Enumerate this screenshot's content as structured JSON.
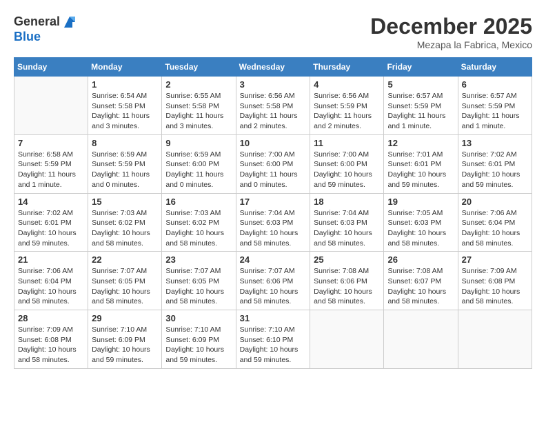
{
  "header": {
    "logo_general": "General",
    "logo_blue": "Blue",
    "month": "December 2025",
    "location": "Mezapa la Fabrica, Mexico"
  },
  "days_of_week": [
    "Sunday",
    "Monday",
    "Tuesday",
    "Wednesday",
    "Thursday",
    "Friday",
    "Saturday"
  ],
  "weeks": [
    [
      {
        "day": "",
        "info": ""
      },
      {
        "day": "1",
        "info": "Sunrise: 6:54 AM\nSunset: 5:58 PM\nDaylight: 11 hours\nand 3 minutes."
      },
      {
        "day": "2",
        "info": "Sunrise: 6:55 AM\nSunset: 5:58 PM\nDaylight: 11 hours\nand 3 minutes."
      },
      {
        "day": "3",
        "info": "Sunrise: 6:56 AM\nSunset: 5:58 PM\nDaylight: 11 hours\nand 2 minutes."
      },
      {
        "day": "4",
        "info": "Sunrise: 6:56 AM\nSunset: 5:59 PM\nDaylight: 11 hours\nand 2 minutes."
      },
      {
        "day": "5",
        "info": "Sunrise: 6:57 AM\nSunset: 5:59 PM\nDaylight: 11 hours\nand 1 minute."
      },
      {
        "day": "6",
        "info": "Sunrise: 6:57 AM\nSunset: 5:59 PM\nDaylight: 11 hours\nand 1 minute."
      }
    ],
    [
      {
        "day": "7",
        "info": "Sunrise: 6:58 AM\nSunset: 5:59 PM\nDaylight: 11 hours\nand 1 minute."
      },
      {
        "day": "8",
        "info": "Sunrise: 6:59 AM\nSunset: 5:59 PM\nDaylight: 11 hours\nand 0 minutes."
      },
      {
        "day": "9",
        "info": "Sunrise: 6:59 AM\nSunset: 6:00 PM\nDaylight: 11 hours\nand 0 minutes."
      },
      {
        "day": "10",
        "info": "Sunrise: 7:00 AM\nSunset: 6:00 PM\nDaylight: 11 hours\nand 0 minutes."
      },
      {
        "day": "11",
        "info": "Sunrise: 7:00 AM\nSunset: 6:00 PM\nDaylight: 10 hours\nand 59 minutes."
      },
      {
        "day": "12",
        "info": "Sunrise: 7:01 AM\nSunset: 6:01 PM\nDaylight: 10 hours\nand 59 minutes."
      },
      {
        "day": "13",
        "info": "Sunrise: 7:02 AM\nSunset: 6:01 PM\nDaylight: 10 hours\nand 59 minutes."
      }
    ],
    [
      {
        "day": "14",
        "info": "Sunrise: 7:02 AM\nSunset: 6:01 PM\nDaylight: 10 hours\nand 59 minutes."
      },
      {
        "day": "15",
        "info": "Sunrise: 7:03 AM\nSunset: 6:02 PM\nDaylight: 10 hours\nand 58 minutes."
      },
      {
        "day": "16",
        "info": "Sunrise: 7:03 AM\nSunset: 6:02 PM\nDaylight: 10 hours\nand 58 minutes."
      },
      {
        "day": "17",
        "info": "Sunrise: 7:04 AM\nSunset: 6:03 PM\nDaylight: 10 hours\nand 58 minutes."
      },
      {
        "day": "18",
        "info": "Sunrise: 7:04 AM\nSunset: 6:03 PM\nDaylight: 10 hours\nand 58 minutes."
      },
      {
        "day": "19",
        "info": "Sunrise: 7:05 AM\nSunset: 6:03 PM\nDaylight: 10 hours\nand 58 minutes."
      },
      {
        "day": "20",
        "info": "Sunrise: 7:06 AM\nSunset: 6:04 PM\nDaylight: 10 hours\nand 58 minutes."
      }
    ],
    [
      {
        "day": "21",
        "info": "Sunrise: 7:06 AM\nSunset: 6:04 PM\nDaylight: 10 hours\nand 58 minutes."
      },
      {
        "day": "22",
        "info": "Sunrise: 7:07 AM\nSunset: 6:05 PM\nDaylight: 10 hours\nand 58 minutes."
      },
      {
        "day": "23",
        "info": "Sunrise: 7:07 AM\nSunset: 6:05 PM\nDaylight: 10 hours\nand 58 minutes."
      },
      {
        "day": "24",
        "info": "Sunrise: 7:07 AM\nSunset: 6:06 PM\nDaylight: 10 hours\nand 58 minutes."
      },
      {
        "day": "25",
        "info": "Sunrise: 7:08 AM\nSunset: 6:06 PM\nDaylight: 10 hours\nand 58 minutes."
      },
      {
        "day": "26",
        "info": "Sunrise: 7:08 AM\nSunset: 6:07 PM\nDaylight: 10 hours\nand 58 minutes."
      },
      {
        "day": "27",
        "info": "Sunrise: 7:09 AM\nSunset: 6:08 PM\nDaylight: 10 hours\nand 58 minutes."
      }
    ],
    [
      {
        "day": "28",
        "info": "Sunrise: 7:09 AM\nSunset: 6:08 PM\nDaylight: 10 hours\nand 58 minutes."
      },
      {
        "day": "29",
        "info": "Sunrise: 7:10 AM\nSunset: 6:09 PM\nDaylight: 10 hours\nand 59 minutes."
      },
      {
        "day": "30",
        "info": "Sunrise: 7:10 AM\nSunset: 6:09 PM\nDaylight: 10 hours\nand 59 minutes."
      },
      {
        "day": "31",
        "info": "Sunrise: 7:10 AM\nSunset: 6:10 PM\nDaylight: 10 hours\nand 59 minutes."
      },
      {
        "day": "",
        "info": ""
      },
      {
        "day": "",
        "info": ""
      },
      {
        "day": "",
        "info": ""
      }
    ]
  ]
}
